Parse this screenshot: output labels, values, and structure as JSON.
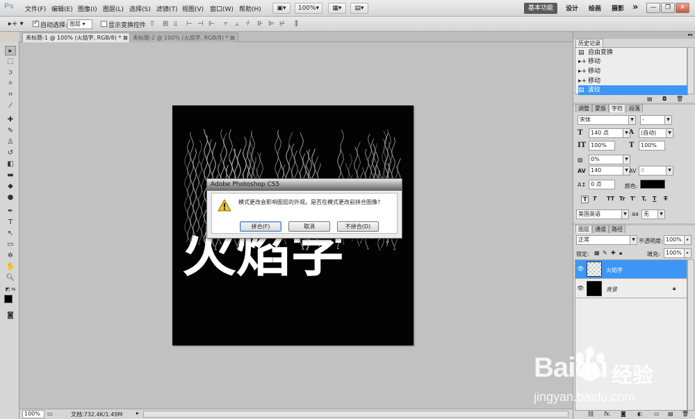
{
  "app": {
    "logo": "Ps",
    "menu": [
      "文件(F)",
      "编辑(E)",
      "图像(I)",
      "图层(L)",
      "选择(S)",
      "滤镜(T)",
      "视图(V)",
      "窗口(W)",
      "帮助(H)"
    ],
    "zoom_label": "100%",
    "workspaces": [
      "基本功能",
      "设计",
      "绘画",
      "摄影"
    ],
    "more_label": "»"
  },
  "options": {
    "auto_select_label": "自动选择:",
    "auto_select_value": "图层",
    "show_transform_label": "显示变换控件"
  },
  "tabs": [
    {
      "label": "未标题-1 @ 100% (火焰字, RGB/8) *",
      "active": true
    },
    {
      "label": "未标题-2 @ 100% (火焰字, RGB/8) *",
      "active": false
    }
  ],
  "canvas": {
    "flame_text": "火焰字"
  },
  "dialog": {
    "title": "Adobe Photoshop CS5",
    "message": "模式更改会影响图层的外观。是否在模式更改前拼合图像?",
    "buttons": {
      "flatten": "拼合(F)",
      "cancel": "取消",
      "dont_flatten": "不拼合(D)"
    }
  },
  "status": {
    "zoom": "100%",
    "doc_info": "文档:732.4K/1.49M"
  },
  "history": {
    "title": "历史记录",
    "items": [
      "自由变换",
      "移动",
      "移动",
      "移动",
      "波纹"
    ],
    "selected_index": 4
  },
  "character": {
    "tabs": [
      "调整",
      "蒙版",
      "字符",
      "段落"
    ],
    "active_tab": "字符",
    "font_family": "宋体",
    "font_style": "-",
    "font_size": "140 点",
    "leading": "(自动)",
    "vertical_scale": "100%",
    "horizontal_scale": "100%",
    "tsume": "0%",
    "tracking": "140",
    "kerning": "0",
    "baseline": "0 点",
    "color_label": "颜色:",
    "color_value": "#000000",
    "language": "美国英语",
    "aa_label": "aa",
    "antialias": "无",
    "style_buttons": [
      "T",
      "T",
      "TT",
      "Tr",
      "T'",
      "T,",
      "T",
      "T"
    ]
  },
  "layers": {
    "tabs": [
      "图层",
      "通道",
      "路径"
    ],
    "blend_mode": "正常",
    "opacity_label": "不透明度:",
    "opacity": "100%",
    "lock_label": "锁定:",
    "fill_label": "填充:",
    "fill": "100%",
    "items": [
      {
        "name": "火焰字",
        "selected": true
      },
      {
        "name": "背景",
        "selected": false
      }
    ]
  },
  "watermark": {
    "brand": "Baidu",
    "product": "经验",
    "url": "jingyan.baidu.com"
  }
}
